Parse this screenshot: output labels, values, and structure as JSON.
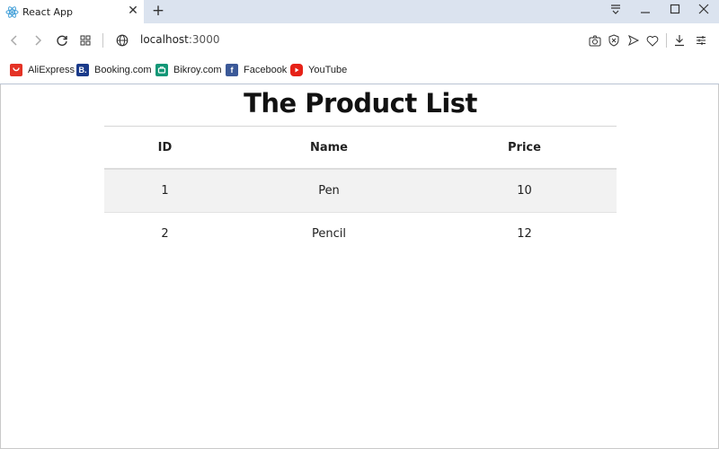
{
  "browser": {
    "tab": {
      "title": "React App",
      "close": "✕",
      "new_tab": "+"
    },
    "address": {
      "host": "localhost",
      "port": ":3000"
    },
    "bookmarks": [
      {
        "label": "AliExpress",
        "icon": "aliexpress-icon",
        "color": "#e43225"
      },
      {
        "label": "Booking.com",
        "icon": "booking-icon",
        "color": "#1a3a8a",
        "glyph": "B."
      },
      {
        "label": "Bikroy.com",
        "icon": "bikroy-icon",
        "color": "#149777"
      },
      {
        "label": "Facebook",
        "icon": "facebook-icon",
        "color": "#3b5998",
        "glyph": "f"
      },
      {
        "label": "YouTube",
        "icon": "youtube-icon",
        "color": "#e62117"
      }
    ]
  },
  "page": {
    "title": "The Product List",
    "table": {
      "headers": [
        "ID",
        "Name",
        "Price"
      ],
      "rows": [
        {
          "id": "1",
          "name": "Pen",
          "price": "10"
        },
        {
          "id": "2",
          "name": "Pencil",
          "price": "12"
        }
      ]
    }
  }
}
